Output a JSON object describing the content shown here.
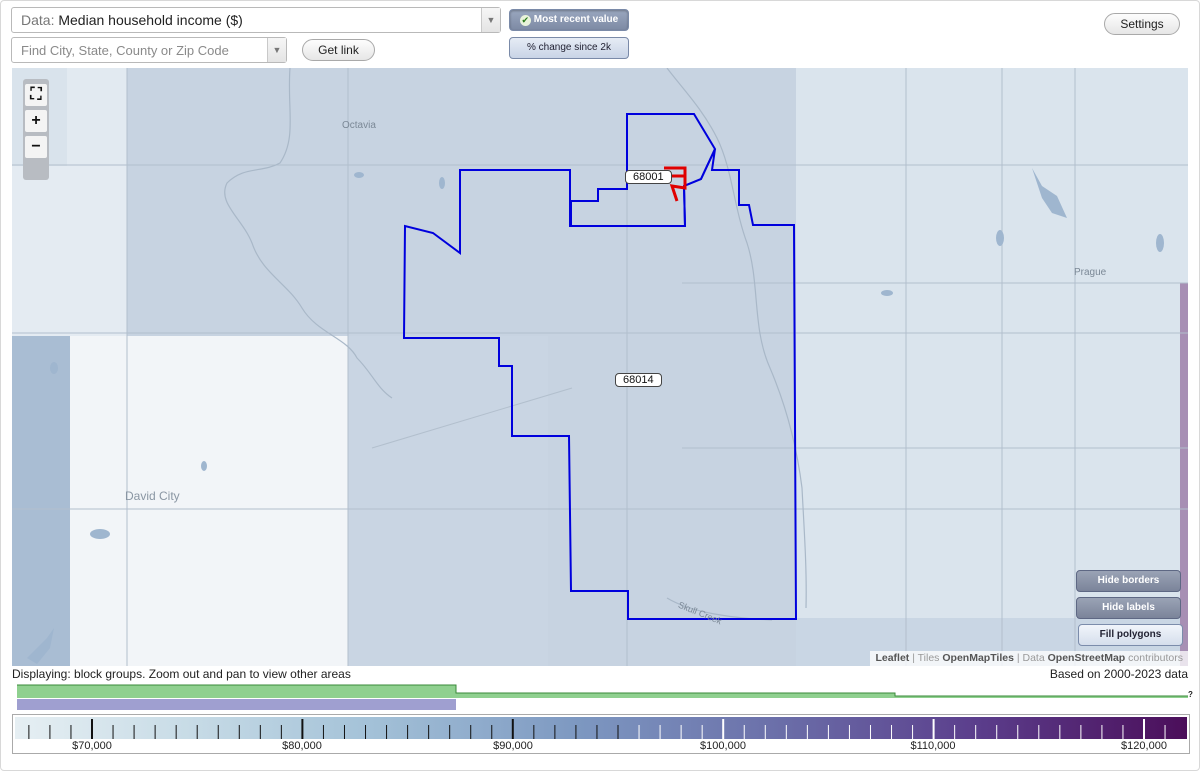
{
  "data_select": {
    "prefix": "Data:",
    "value": "Median household income ($)"
  },
  "search": {
    "placeholder": "Find City, State, County or Zip Code"
  },
  "buttons": {
    "get_link": "Get link",
    "most_recent": "Most recent value",
    "pct_change": "% change since 2k",
    "settings": "Settings",
    "hide_borders": "Hide borders",
    "hide_labels": "Hide labels",
    "fill_polygons": "Fill polygons"
  },
  "map": {
    "places": [
      "Octavia",
      "Prague",
      "David City",
      "Skull Creek"
    ],
    "zip_labels": [
      "68001",
      "68014"
    ],
    "zoom_in": "+",
    "zoom_out": "−",
    "fullscreen_icon": "fullscreen-icon"
  },
  "attribution": {
    "leaflet": "Leaflet",
    "sep1": " | Tiles ",
    "tiles": "OpenMapTiles",
    "sep2": " | Data ",
    "data": "OpenStreetMap",
    "contributors": " contributors"
  },
  "status": {
    "displaying": "Displaying: block groups. Zoom out and pan to view other areas",
    "based_on": "Based on 2000-2023 data"
  },
  "histogram": {
    "unknown_mark": "?"
  },
  "legend": {
    "ticks": [
      "$70,000",
      "$80,000",
      "$90,000",
      "$100,000",
      "$110,000",
      "$120,000"
    ],
    "min": 64000,
    "max": 122000
  },
  "colors": {
    "boundary": "#0000dd",
    "highlight": "#e00000",
    "hist_green": "#8fd08f",
    "hist_purple": "#9f9fd0"
  }
}
